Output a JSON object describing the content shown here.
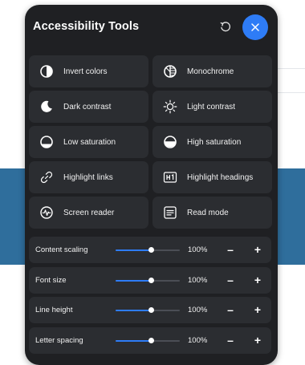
{
  "panel": {
    "title": "Accessibility Tools",
    "accent_color": "#2e7cf6",
    "reset_icon": "reset-icon",
    "close_icon": "close-icon"
  },
  "tools": [
    {
      "label": "Invert colors",
      "icon": "invert-colors-icon"
    },
    {
      "label": "Monochrome",
      "icon": "monochrome-icon"
    },
    {
      "label": "Dark contrast",
      "icon": "moon-icon"
    },
    {
      "label": "Light contrast",
      "icon": "sun-icon"
    },
    {
      "label": "Low saturation",
      "icon": "low-saturation-icon"
    },
    {
      "label": "High saturation",
      "icon": "high-saturation-icon"
    },
    {
      "label": "Highlight links",
      "icon": "link-icon"
    },
    {
      "label": "Highlight headings",
      "icon": "heading-h1-icon"
    },
    {
      "label": "Screen reader",
      "icon": "screen-reader-icon"
    },
    {
      "label": "Read mode",
      "icon": "read-mode-icon"
    }
  ],
  "sliders": [
    {
      "label": "Content scaling",
      "value": "100%",
      "level": 0.55,
      "minus": "–",
      "plus": "+"
    },
    {
      "label": "Font size",
      "value": "100%",
      "level": 0.55,
      "minus": "–",
      "plus": "+"
    },
    {
      "label": "Line height",
      "value": "100%",
      "level": 0.55,
      "minus": "–",
      "plus": "+"
    },
    {
      "label": "Letter spacing",
      "value": "100%",
      "level": 0.55,
      "minus": "–",
      "plus": "+"
    }
  ]
}
